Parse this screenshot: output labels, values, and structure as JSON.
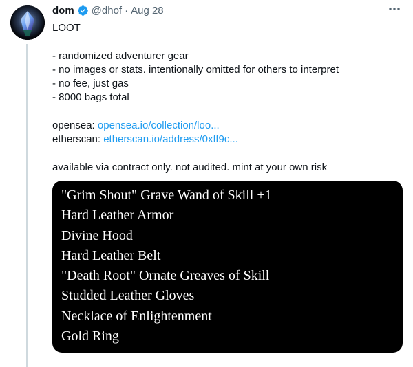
{
  "author": {
    "name": "dom",
    "handle": "@dhof",
    "separator": "·",
    "date": "Aug 28",
    "verified_color": "#1d9bf0"
  },
  "tweet": {
    "title": "LOOT",
    "bullets": [
      "- randomized adventurer gear",
      "- no images or stats. intentionally omitted for others to interpret",
      "- no fee, just gas",
      "- 8000 bags total"
    ],
    "links": [
      {
        "label": "opensea:",
        "url_text": "opensea.io/collection/loo..."
      },
      {
        "label": "etherscan:",
        "url_text": "etherscan.io/address/0xff9c..."
      }
    ],
    "footer": "available via contract only. not audited. mint at your own risk"
  },
  "loot_card": {
    "items": [
      "\"Grim Shout\" Grave Wand of Skill +1",
      "Hard Leather Armor",
      "Divine Hood",
      "Hard Leather Belt",
      "\"Death Root\" Ornate Greaves of Skill",
      "Studded Leather Gloves",
      "Necklace of Enlightenment",
      "Gold Ring"
    ]
  },
  "icons": {
    "avatar": "avatar-image",
    "verified": "verified-badge-icon",
    "more": "more-options-icon"
  },
  "colors": {
    "link": "#1d9bf0",
    "muted": "#536471",
    "text": "#0f1419",
    "card_background": "#000000",
    "thread_line": "#cfd9de"
  }
}
